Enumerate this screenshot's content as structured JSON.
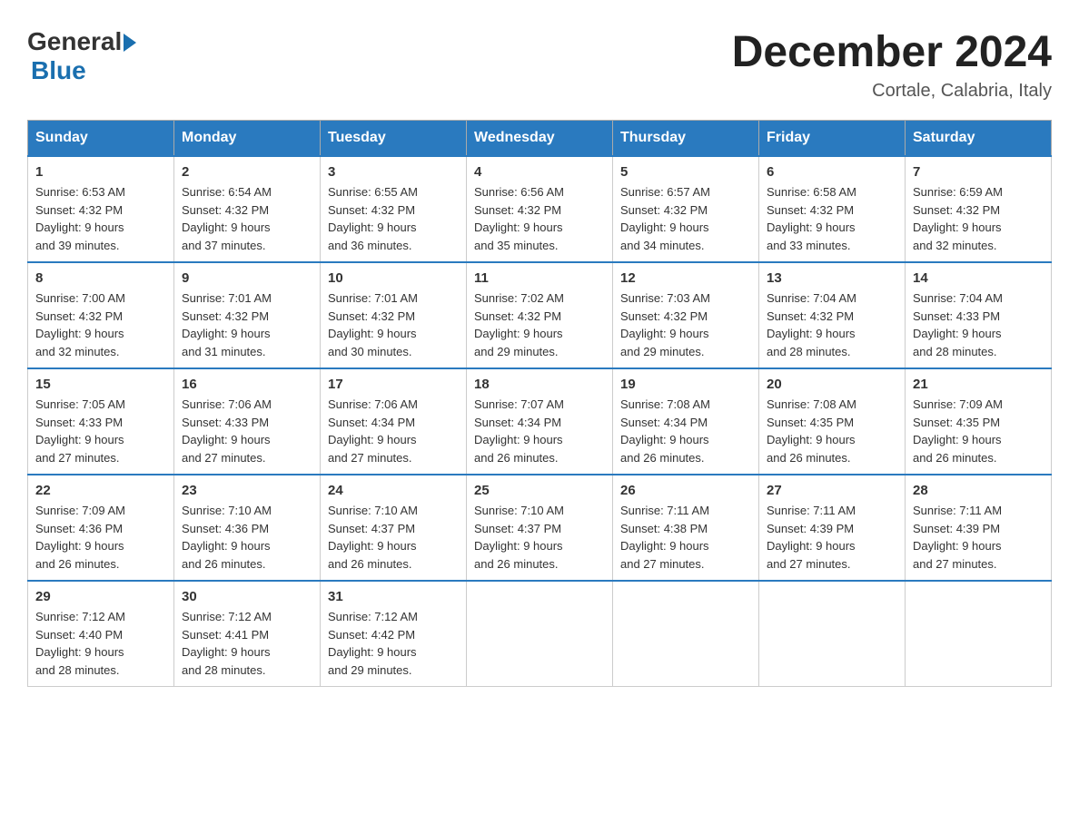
{
  "header": {
    "logo_general": "General",
    "logo_blue": "Blue",
    "title": "December 2024",
    "subtitle": "Cortale, Calabria, Italy"
  },
  "days_of_week": [
    "Sunday",
    "Monday",
    "Tuesday",
    "Wednesday",
    "Thursday",
    "Friday",
    "Saturday"
  ],
  "weeks": [
    [
      {
        "day": "1",
        "sunrise": "6:53 AM",
        "sunset": "4:32 PM",
        "daylight": "9 hours and 39 minutes."
      },
      {
        "day": "2",
        "sunrise": "6:54 AM",
        "sunset": "4:32 PM",
        "daylight": "9 hours and 37 minutes."
      },
      {
        "day": "3",
        "sunrise": "6:55 AM",
        "sunset": "4:32 PM",
        "daylight": "9 hours and 36 minutes."
      },
      {
        "day": "4",
        "sunrise": "6:56 AM",
        "sunset": "4:32 PM",
        "daylight": "9 hours and 35 minutes."
      },
      {
        "day": "5",
        "sunrise": "6:57 AM",
        "sunset": "4:32 PM",
        "daylight": "9 hours and 34 minutes."
      },
      {
        "day": "6",
        "sunrise": "6:58 AM",
        "sunset": "4:32 PM",
        "daylight": "9 hours and 33 minutes."
      },
      {
        "day": "7",
        "sunrise": "6:59 AM",
        "sunset": "4:32 PM",
        "daylight": "9 hours and 32 minutes."
      }
    ],
    [
      {
        "day": "8",
        "sunrise": "7:00 AM",
        "sunset": "4:32 PM",
        "daylight": "9 hours and 32 minutes."
      },
      {
        "day": "9",
        "sunrise": "7:01 AM",
        "sunset": "4:32 PM",
        "daylight": "9 hours and 31 minutes."
      },
      {
        "day": "10",
        "sunrise": "7:01 AM",
        "sunset": "4:32 PM",
        "daylight": "9 hours and 30 minutes."
      },
      {
        "day": "11",
        "sunrise": "7:02 AM",
        "sunset": "4:32 PM",
        "daylight": "9 hours and 29 minutes."
      },
      {
        "day": "12",
        "sunrise": "7:03 AM",
        "sunset": "4:32 PM",
        "daylight": "9 hours and 29 minutes."
      },
      {
        "day": "13",
        "sunrise": "7:04 AM",
        "sunset": "4:32 PM",
        "daylight": "9 hours and 28 minutes."
      },
      {
        "day": "14",
        "sunrise": "7:04 AM",
        "sunset": "4:33 PM",
        "daylight": "9 hours and 28 minutes."
      }
    ],
    [
      {
        "day": "15",
        "sunrise": "7:05 AM",
        "sunset": "4:33 PM",
        "daylight": "9 hours and 27 minutes."
      },
      {
        "day": "16",
        "sunrise": "7:06 AM",
        "sunset": "4:33 PM",
        "daylight": "9 hours and 27 minutes."
      },
      {
        "day": "17",
        "sunrise": "7:06 AM",
        "sunset": "4:34 PM",
        "daylight": "9 hours and 27 minutes."
      },
      {
        "day": "18",
        "sunrise": "7:07 AM",
        "sunset": "4:34 PM",
        "daylight": "9 hours and 26 minutes."
      },
      {
        "day": "19",
        "sunrise": "7:08 AM",
        "sunset": "4:34 PM",
        "daylight": "9 hours and 26 minutes."
      },
      {
        "day": "20",
        "sunrise": "7:08 AM",
        "sunset": "4:35 PM",
        "daylight": "9 hours and 26 minutes."
      },
      {
        "day": "21",
        "sunrise": "7:09 AM",
        "sunset": "4:35 PM",
        "daylight": "9 hours and 26 minutes."
      }
    ],
    [
      {
        "day": "22",
        "sunrise": "7:09 AM",
        "sunset": "4:36 PM",
        "daylight": "9 hours and 26 minutes."
      },
      {
        "day": "23",
        "sunrise": "7:10 AM",
        "sunset": "4:36 PM",
        "daylight": "9 hours and 26 minutes."
      },
      {
        "day": "24",
        "sunrise": "7:10 AM",
        "sunset": "4:37 PM",
        "daylight": "9 hours and 26 minutes."
      },
      {
        "day": "25",
        "sunrise": "7:10 AM",
        "sunset": "4:37 PM",
        "daylight": "9 hours and 26 minutes."
      },
      {
        "day": "26",
        "sunrise": "7:11 AM",
        "sunset": "4:38 PM",
        "daylight": "9 hours and 27 minutes."
      },
      {
        "day": "27",
        "sunrise": "7:11 AM",
        "sunset": "4:39 PM",
        "daylight": "9 hours and 27 minutes."
      },
      {
        "day": "28",
        "sunrise": "7:11 AM",
        "sunset": "4:39 PM",
        "daylight": "9 hours and 27 minutes."
      }
    ],
    [
      {
        "day": "29",
        "sunrise": "7:12 AM",
        "sunset": "4:40 PM",
        "daylight": "9 hours and 28 minutes."
      },
      {
        "day": "30",
        "sunrise": "7:12 AM",
        "sunset": "4:41 PM",
        "daylight": "9 hours and 28 minutes."
      },
      {
        "day": "31",
        "sunrise": "7:12 AM",
        "sunset": "4:42 PM",
        "daylight": "9 hours and 29 minutes."
      },
      null,
      null,
      null,
      null
    ]
  ],
  "labels": {
    "sunrise": "Sunrise:",
    "sunset": "Sunset:",
    "daylight": "Daylight:"
  }
}
